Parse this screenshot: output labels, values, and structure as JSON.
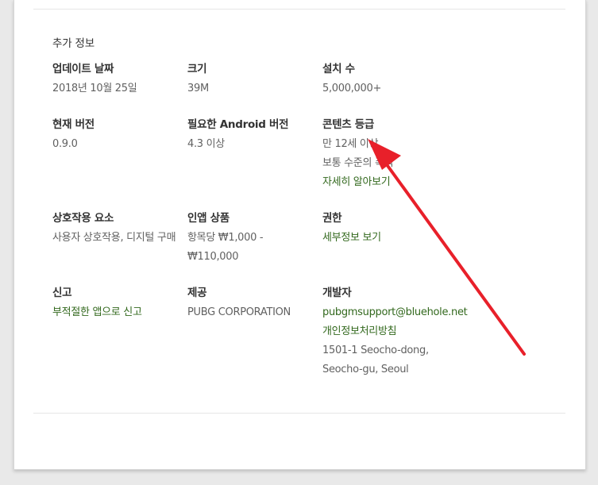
{
  "additional_info": {
    "section_title": "추가 정보",
    "updated": {
      "label": "업데이트 날짜",
      "value": "2018년 10월 25일"
    },
    "size": {
      "label": "크기",
      "value": "39M"
    },
    "installs": {
      "label": "설치 수",
      "value": "5,000,000+"
    },
    "current_version": {
      "label": "현재 버전",
      "value": "0.9.0"
    },
    "requires_android": {
      "label": "필요한 Android 버전",
      "value": "4.3 이상"
    },
    "content_rating": {
      "label": "콘텐츠 등급",
      "value": "만 12세 이상",
      "descriptor": "보통 수준의 폭력",
      "learn_more": "자세히 알아보기"
    },
    "interactive_elements": {
      "label": "상호작용 요소",
      "value": "사용자 상호작용, 디지털 구매"
    },
    "in_app_products": {
      "label": "인앱 상품",
      "value": "항목당 ₩1,000 - ₩110,000"
    },
    "permissions": {
      "label": "권한",
      "link": "세부정보 보기"
    },
    "report": {
      "label": "신고",
      "link": "부적절한 앱으로 신고"
    },
    "offered_by": {
      "label": "제공",
      "value": "PUBG CORPORATION"
    },
    "developer": {
      "label": "개발자",
      "email": "pubgmsupport@bluehole.net",
      "privacy": "개인정보처리방침",
      "address_line1": "1501-1 Seocho-dong,",
      "address_line2": "Seocho-gu, Seoul"
    }
  },
  "colors": {
    "link_green": "#33691e",
    "arrow_red": "#e8202a",
    "label_text": "#333333",
    "value_text": "#616161"
  }
}
